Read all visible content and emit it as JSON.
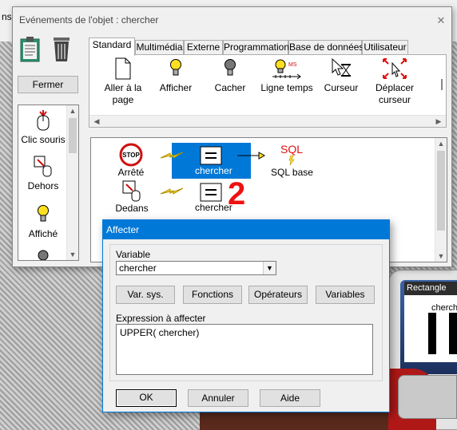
{
  "background": {
    "top_text": "ns",
    "mini_window_title": "Rectangle",
    "mini_window_text": "cherch"
  },
  "main_window": {
    "title": "Evénements de l'objet : chercher",
    "close_glyph": "✕",
    "close_button": "Fermer",
    "events": [
      {
        "label": "Clic souris",
        "icon": "mouse-click-icon"
      },
      {
        "label": "Dehors",
        "icon": "mouse-out-icon"
      },
      {
        "label": "Affiché",
        "icon": "bulb-on-icon"
      },
      {
        "label": "",
        "icon": "bulb-off-icon"
      }
    ],
    "tabs": [
      "Standard",
      "Multimédia",
      "Externe",
      "Programmation",
      "Base de données",
      "Utilisateur"
    ],
    "actions": [
      {
        "label_line1": "Aller à la",
        "label_line2": "page",
        "icon": "page-icon"
      },
      {
        "label_line1": "Afficher",
        "label_line2": "",
        "icon": "bulb-on-icon"
      },
      {
        "label_line1": "Cacher",
        "label_line2": "",
        "icon": "bulb-off-icon"
      },
      {
        "label_line1": "Ligne temps",
        "label_line2": "",
        "icon": "timeline-icon"
      },
      {
        "label_line1": "Curseur",
        "label_line2": "",
        "icon": "cursor-hourglass-icon"
      },
      {
        "label_line1": "Déplacer",
        "label_line2": "curseur",
        "icon": "move-cursor-icon"
      }
    ],
    "canvas": {
      "nodes": [
        {
          "label": "Arrêté",
          "icon": "stop-icon",
          "icon_text": "STOP"
        },
        {
          "label": "chercher",
          "icon": "equals-icon"
        },
        {
          "label": "SQL base",
          "icon": "sql-icon",
          "icon_text": "SQL"
        },
        {
          "label": "Dedans",
          "icon": "mouse-in-icon"
        },
        {
          "label": "chercher",
          "icon": "equals-icon"
        }
      ],
      "step_number": "2"
    }
  },
  "dialog": {
    "title": "Affecter",
    "variable_label": "Variable",
    "variable_value": "chercher",
    "buttons_row": [
      "Var. sys.",
      "Fonctions",
      "Opérateurs",
      "Variables"
    ],
    "expression_label": "Expression à affecter",
    "expression_value": "UPPER( chercher)",
    "ok": "OK",
    "cancel": "Annuler",
    "help": "Aide"
  },
  "colors": {
    "accent": "#0078d7",
    "step_number": "#ee1111",
    "sql_text": "#e01010"
  }
}
